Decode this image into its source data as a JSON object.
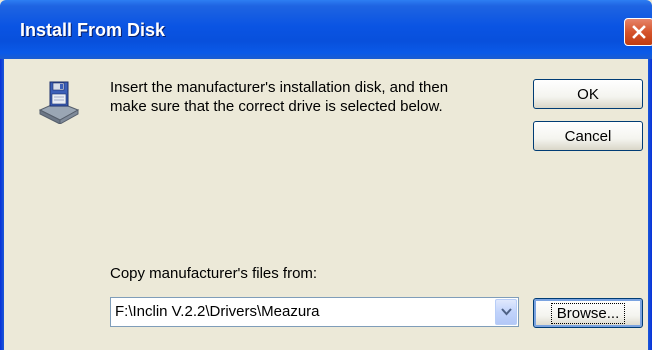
{
  "window": {
    "title": "Install From Disk"
  },
  "titlebar": {
    "close_icon": "close-icon"
  },
  "message": {
    "line1": "Insert the manufacturer's installation disk, and then",
    "line2": "make sure that the correct drive is selected below."
  },
  "buttons": {
    "ok_label": "OK",
    "cancel_label": "Cancel",
    "browse_label": "Browse..."
  },
  "copy_from": {
    "label": "Copy manufacturer's files from:",
    "value": "F:\\Inclin V.2.2\\Drivers\\Meazura"
  },
  "icons": {
    "disk": "floppy-disk-drive-icon",
    "dropdown": "chevron-down-icon"
  },
  "colors": {
    "titlebar": "#0a54e3",
    "dialog_bg": "#ece9d8",
    "close_button": "#d5542c"
  }
}
